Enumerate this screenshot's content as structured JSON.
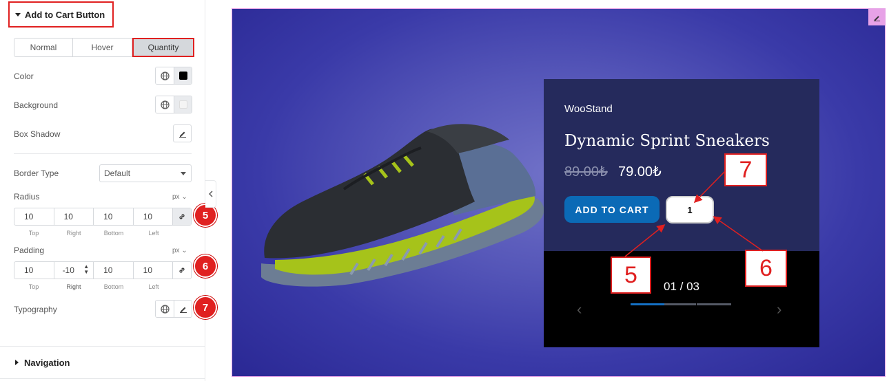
{
  "panel": {
    "section_title": "Add to Cart Button",
    "tabs": [
      "Normal",
      "Hover",
      "Quantity"
    ],
    "active_tab": "Quantity",
    "color_label": "Color",
    "color_value": "#000000",
    "background_label": "Background",
    "background_value": "#f1f1f1",
    "box_shadow_label": "Box Shadow",
    "border_type_label": "Border Type",
    "border_type_value": "Default",
    "radius_label": "Radius",
    "radius_unit": "px",
    "radius_values": [
      "10",
      "10",
      "10",
      "10"
    ],
    "padding_label": "Padding",
    "padding_unit": "px",
    "padding_values": [
      "10",
      "-10",
      "10",
      "10"
    ],
    "side_labels": [
      "Top",
      "Right",
      "Bottom",
      "Left"
    ],
    "typography_label": "Typography",
    "navigation_label": "Navigation",
    "badges": [
      "5",
      "6",
      "7"
    ]
  },
  "preview": {
    "store_name": "WooStand",
    "product_title": "Dynamic Sprint Sneakers",
    "old_price": "89.00₺",
    "new_price": "79.00₺",
    "add_to_cart_label": "ADD TO CART",
    "quantity_value": "1",
    "slide_counter": "01 / 03",
    "slide_progress": 0.3333,
    "arrow_prev": "‹",
    "arrow_next": "›",
    "callouts": [
      "7",
      "5",
      "6"
    ],
    "accent_color": "#0b6ab6",
    "callout_color": "#e02020"
  }
}
